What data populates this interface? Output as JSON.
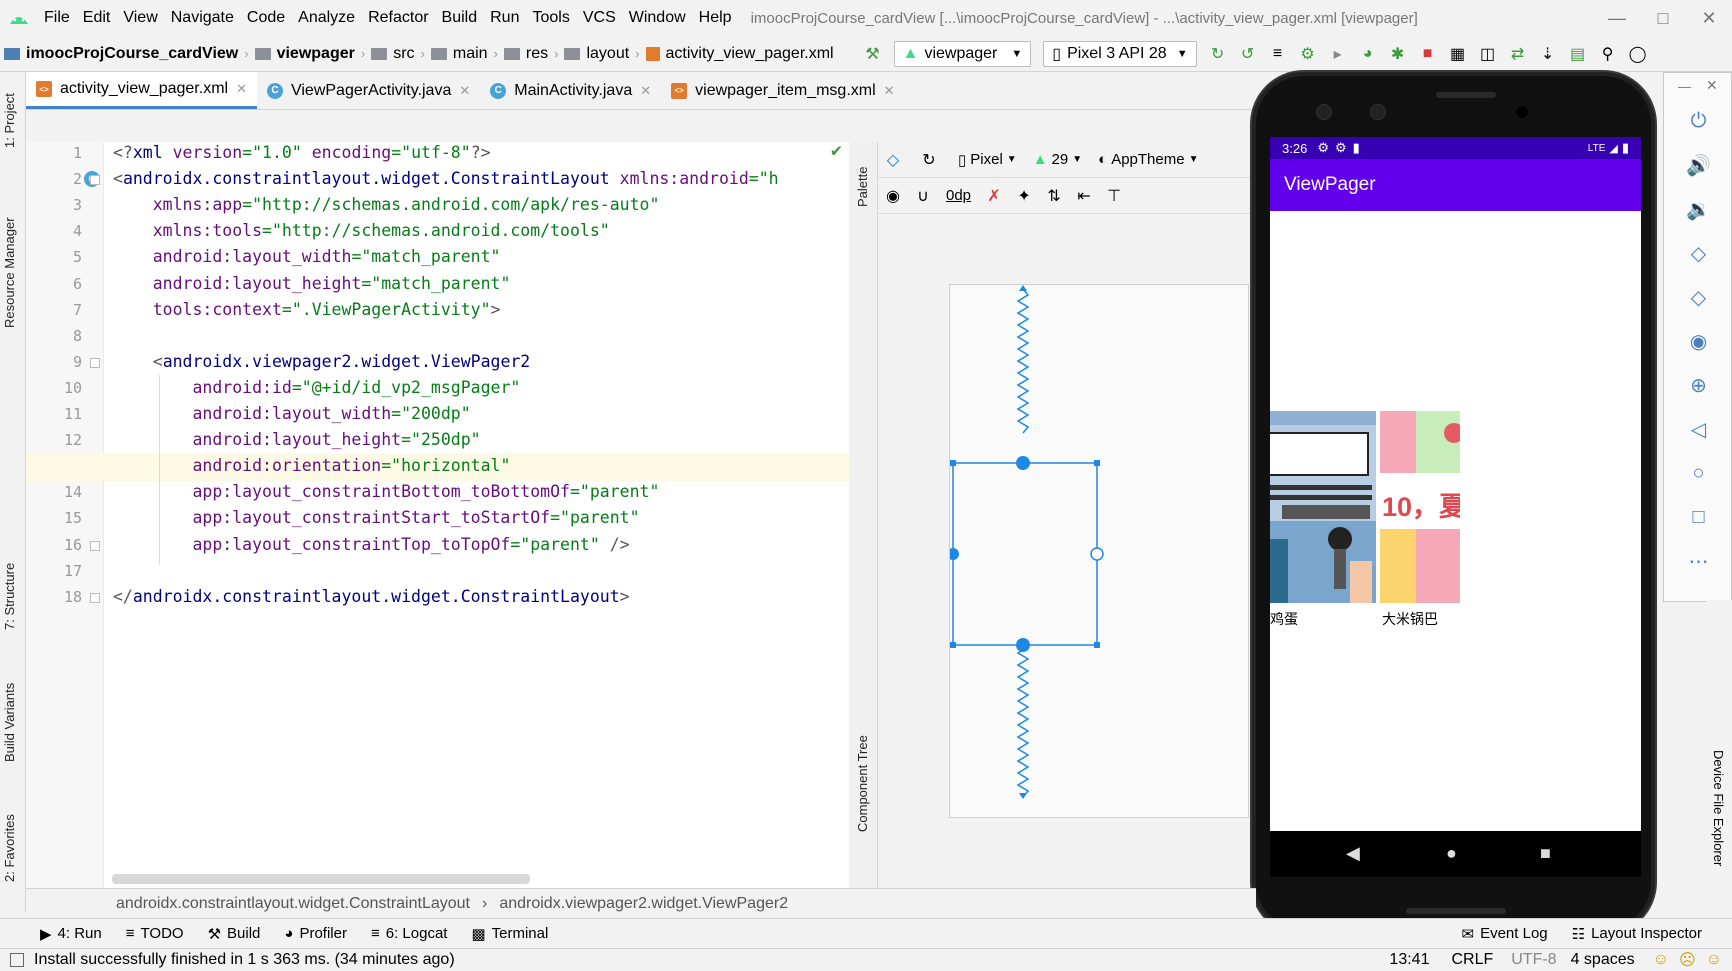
{
  "menu": {
    "items": [
      "File",
      "Edit",
      "View",
      "Navigate",
      "Code",
      "Analyze",
      "Refactor",
      "Build",
      "Run",
      "Tools",
      "VCS",
      "Window",
      "Help"
    ],
    "title": "imoocProjCourse_cardView [...\\imoocProjCourse_cardView] - ...\\activity_view_pager.xml [viewpager]"
  },
  "nav": {
    "crumbs": [
      "imoocProjCourse_cardView",
      "viewpager",
      "src",
      "main",
      "res",
      "layout",
      "activity_view_pager.xml"
    ],
    "run_config": "viewpager",
    "device": "Pixel 3 API 28"
  },
  "tabs": [
    {
      "label": "activity_view_pager.xml",
      "type": "xml",
      "active": true
    },
    {
      "label": "ViewPagerActivity.java",
      "type": "class",
      "active": false
    },
    {
      "label": "MainActivity.java",
      "type": "class",
      "active": false
    },
    {
      "label": "viewpager_item_msg.xml",
      "type": "xml",
      "active": false
    }
  ],
  "left_strip": [
    "1: Project",
    "Resource Manager",
    "7: Structure",
    "Build Variants",
    "2: Favorites"
  ],
  "editor": {
    "highlight_line": 13,
    "lines": [
      {
        "n": "1",
        "segs": [
          [
            "gray",
            "<?"
          ],
          [
            "kw",
            "xml "
          ],
          [
            "at",
            "version"
          ],
          [
            "st",
            "=\"1.0\" "
          ],
          [
            "at",
            "encoding"
          ],
          [
            "st",
            "=\"utf-8\""
          ],
          [
            "gray",
            "?>"
          ]
        ]
      },
      {
        "n": "2",
        "segs": [
          [
            "gray",
            "<"
          ],
          [
            "tg",
            "androidx.constraintlayout.widget.ConstraintLayout "
          ],
          [
            "at",
            "xmlns:android"
          ],
          [
            "st",
            "=\"h"
          ]
        ]
      },
      {
        "n": "3",
        "segs": [
          [
            "st",
            "    "
          ],
          [
            "at",
            "xmlns:app"
          ],
          [
            "st",
            "=\"http://schemas.android.com/apk/res-auto\""
          ]
        ]
      },
      {
        "n": "4",
        "segs": [
          [
            "st",
            "    "
          ],
          [
            "at",
            "xmlns:tools"
          ],
          [
            "st",
            "=\"http://schemas.android.com/tools\""
          ]
        ]
      },
      {
        "n": "5",
        "segs": [
          [
            "st",
            "    "
          ],
          [
            "at",
            "android:layout_width"
          ],
          [
            "st",
            "=\"match_parent\""
          ]
        ]
      },
      {
        "n": "6",
        "segs": [
          [
            "st",
            "    "
          ],
          [
            "at",
            "android:layout_height"
          ],
          [
            "st",
            "=\"match_parent\""
          ]
        ]
      },
      {
        "n": "7",
        "segs": [
          [
            "st",
            "    "
          ],
          [
            "at",
            "tools:context"
          ],
          [
            "st",
            "=\".ViewPagerActivity\""
          ],
          [
            "gray",
            ">"
          ]
        ]
      },
      {
        "n": "8",
        "segs": []
      },
      {
        "n": "9",
        "segs": [
          [
            "st",
            "    "
          ],
          [
            "gray",
            "<"
          ],
          [
            "tg",
            "androidx.viewpager2.widget.ViewPager2"
          ]
        ]
      },
      {
        "n": "10",
        "segs": [
          [
            "st",
            "        "
          ],
          [
            "at",
            "android:id"
          ],
          [
            "st",
            "=\"@+id/id_vp2_msgPager\""
          ]
        ]
      },
      {
        "n": "11",
        "segs": [
          [
            "st",
            "        "
          ],
          [
            "at",
            "android:layout_width"
          ],
          [
            "st",
            "=\"200dp\""
          ]
        ]
      },
      {
        "n": "12",
        "segs": [
          [
            "st",
            "        "
          ],
          [
            "at",
            "android:layout_height"
          ],
          [
            "st",
            "=\"250dp\""
          ]
        ]
      },
      {
        "n": "13",
        "segs": [
          [
            "st",
            "        "
          ],
          [
            "at",
            "android:orientation"
          ],
          [
            "st",
            "=\"horizontal\""
          ]
        ]
      },
      {
        "n": "14",
        "segs": [
          [
            "st",
            "        "
          ],
          [
            "at",
            "app:layout_constraintBottom_toBottomOf"
          ],
          [
            "st",
            "=\"parent\""
          ]
        ]
      },
      {
        "n": "15",
        "segs": [
          [
            "st",
            "        "
          ],
          [
            "at",
            "app:layout_constraintStart_toStartOf"
          ],
          [
            "st",
            "=\"parent\""
          ]
        ]
      },
      {
        "n": "16",
        "segs": [
          [
            "st",
            "        "
          ],
          [
            "at",
            "app:layout_constraintTop_toTopOf"
          ],
          [
            "st",
            "=\"parent\" "
          ],
          [
            "gray",
            "/>"
          ]
        ]
      },
      {
        "n": "17",
        "segs": []
      },
      {
        "n": "18",
        "segs": [
          [
            "gray",
            "</"
          ],
          [
            "tg",
            "androidx.constraintlayout.widget.ConstraintLayout"
          ],
          [
            "gray",
            ">"
          ]
        ]
      }
    ]
  },
  "design": {
    "palette_label": "Palette",
    "component_tree_label": "Component Tree",
    "device": "Pixel",
    "api": "29",
    "theme": "AppTheme",
    "margin": "0dp"
  },
  "phone": {
    "time": "3:26",
    "signal": "LTE",
    "app_title": "ViewPager",
    "cards": [
      {
        "label": "鸡蛋",
        "style": "news"
      },
      {
        "label": "大米锅巴",
        "style": "summer"
      }
    ],
    "summer_text": "10，夏"
  },
  "emulator": {
    "buttons": [
      "power-icon",
      "volume-up-icon",
      "volume-down-icon",
      "rotate-left-icon",
      "rotate-right-icon",
      "camera-icon",
      "zoom-icon",
      "back-icon",
      "home-icon",
      "overview-icon",
      "more-icon"
    ]
  },
  "right_strip": [
    "Device File Explorer"
  ],
  "bottom_crumb": [
    "androidx.constraintlayout.widget.ConstraintLayout",
    "androidx.viewpager2.widget.ViewPager2"
  ],
  "bottom_tools": [
    {
      "label": "4: Run",
      "icon": "run-icon"
    },
    {
      "label": "TODO",
      "icon": "todo-icon"
    },
    {
      "label": "Build",
      "icon": "build-icon"
    },
    {
      "label": "Profiler",
      "icon": "profiler-icon"
    },
    {
      "label": "6: Logcat",
      "icon": "logcat-icon"
    },
    {
      "label": "Terminal",
      "icon": "terminal-icon"
    }
  ],
  "bottom_right_tools": [
    "Event Log",
    "Layout Inspector"
  ],
  "status": {
    "message": "Install successfully finished in 1 s 363 ms. (34 minutes ago)",
    "position": "13:41",
    "line_sep": "CRLF",
    "encoding": "UTF-8",
    "indent": "4 spaces"
  },
  "colors": {
    "accent": "#6200ee",
    "status": "#3700b3",
    "selection": "#1e88e5"
  }
}
